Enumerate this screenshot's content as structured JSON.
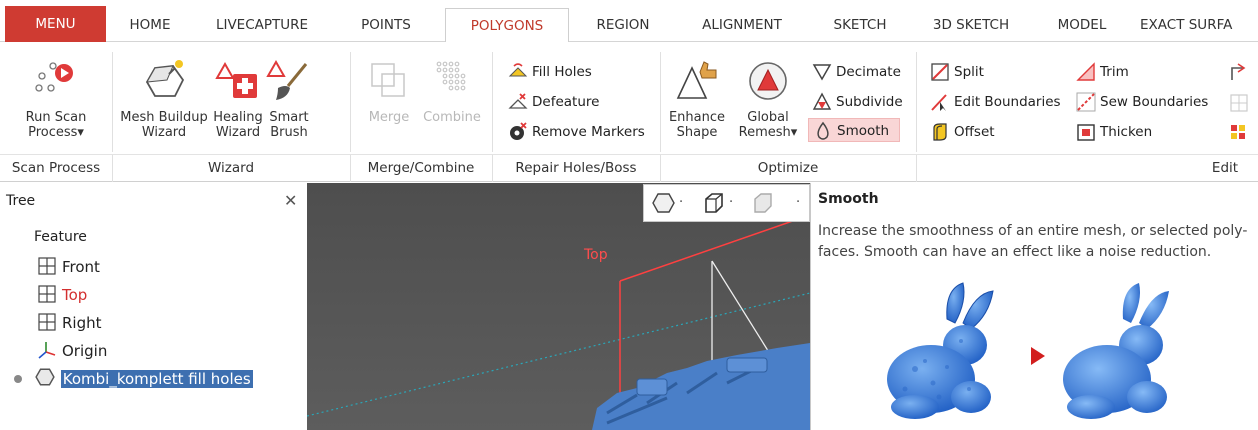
{
  "tabs": [
    {
      "label": "MENU"
    },
    {
      "label": "HOME"
    },
    {
      "label": "LIVECAPTURE"
    },
    {
      "label": "POINTS"
    },
    {
      "label": "POLYGONS"
    },
    {
      "label": "REGION"
    },
    {
      "label": "ALIGNMENT"
    },
    {
      "label": "SKETCH"
    },
    {
      "label": "3D SKETCH"
    },
    {
      "label": "MODEL"
    },
    {
      "label": "EXACT SURFA"
    }
  ],
  "ribbon": {
    "scan_process": {
      "run_scan_line1": "Run Scan",
      "run_scan_line2": "Process▾",
      "group_label": "Scan Process"
    },
    "wizard": {
      "mesh_buildup_line1": "Mesh Buildup",
      "mesh_buildup_line2": "Wizard",
      "healing_line1": "Healing",
      "healing_line2": "Wizard",
      "smart_brush_line1": "Smart",
      "smart_brush_line2": "Brush",
      "group_label": "Wizard"
    },
    "merge_combine": {
      "merge": "Merge",
      "combine": "Combine",
      "group_label": "Merge/Combine"
    },
    "repair": {
      "fill_holes": "Fill Holes",
      "defeature": "Defeature",
      "remove_markers": "Remove Markers",
      "group_label": "Repair Holes/Boss"
    },
    "optimize": {
      "enhance_line1": "Enhance",
      "enhance_line2": "Shape",
      "global_line1": "Global",
      "global_line2": "Remesh▾",
      "decimate": "Decimate",
      "subdivide": "Subdivide",
      "smooth": "Smooth",
      "group_label": "Optimize"
    },
    "edit": {
      "split": "Split",
      "edit_boundaries": "Edit Boundaries",
      "offset": "Offset",
      "trim": "Trim",
      "sew_boundaries": "Sew Boundaries",
      "thicken": "Thicken",
      "group_label": "Edit"
    }
  },
  "tree": {
    "title": "Tree",
    "feature_label": "Feature",
    "items": [
      {
        "label": "Front"
      },
      {
        "label": "Top"
      },
      {
        "label": "Right"
      },
      {
        "label": "Origin"
      },
      {
        "label": "Kombi_komplett fill holes"
      }
    ]
  },
  "viewport": {
    "plane_label": "Top"
  },
  "tooltip": {
    "title": "Smooth",
    "description": "Increase the smoothness of an entire mesh, or selected poly-faces. Smooth can have an effect like a noise reduction."
  },
  "colors": {
    "menu_red": "#cf3b32",
    "active_tab_text": "#c0392b",
    "mesh_blue": "#4a7fc8",
    "selection": "#3d6fb0"
  }
}
